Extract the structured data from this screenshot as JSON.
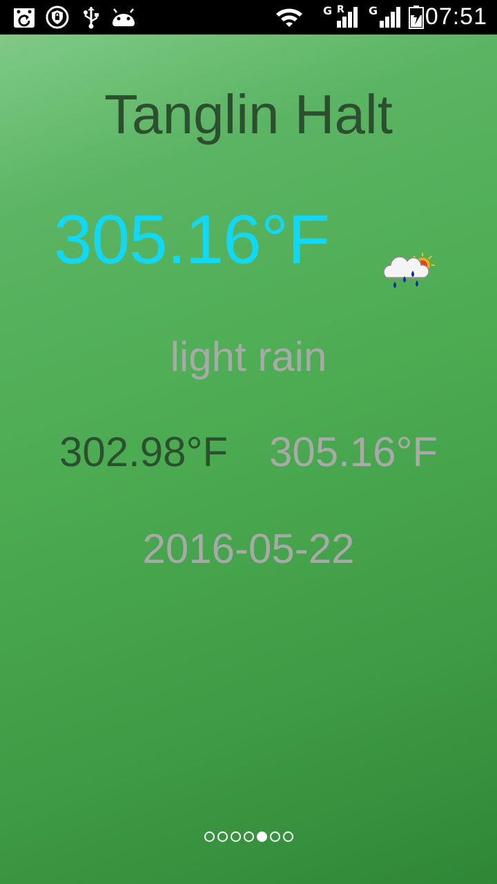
{
  "status_bar": {
    "time": "07:51",
    "icons": [
      "calendar-sync-icon",
      "shield-lock-icon",
      "usb-icon",
      "android-icon",
      "wifi-icon",
      "signal-g-roaming-icon",
      "signal-g-icon",
      "battery-charging-icon"
    ],
    "signal_label_1": "G",
    "signal_label_1_roaming": "R",
    "signal_label_2": "G"
  },
  "weather": {
    "city": "Tanglin Halt",
    "current_temp": "305.16°F",
    "description": "light rain",
    "temp_min": "302.98°F",
    "temp_max": "305.16°F",
    "date": "2016-05-22",
    "icon": "light-rain-sun-icon"
  },
  "pager": {
    "total_pages": 7,
    "active_page": 5
  },
  "colors": {
    "current_temp": "#12d8f5",
    "city_text": "#2c4f2f",
    "muted_text": "#a9a9a9",
    "background_top": "#7fca86",
    "background_bottom": "#2f8736"
  }
}
